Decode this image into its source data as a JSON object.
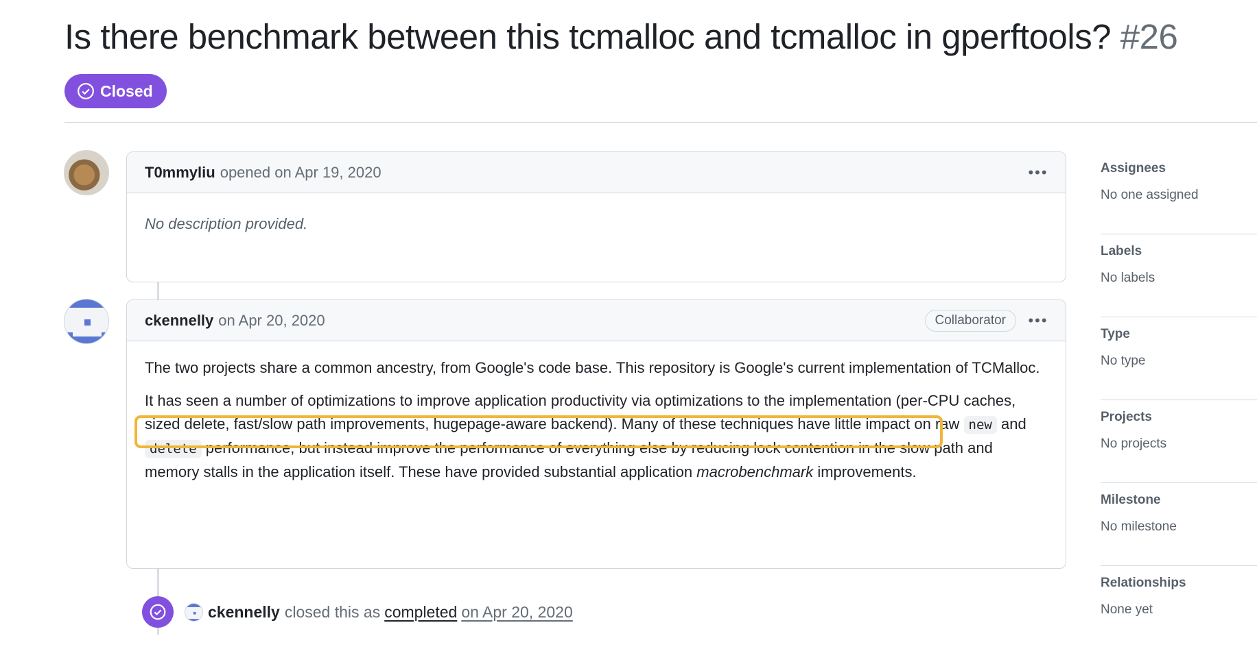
{
  "issue": {
    "title": "Is there benchmark between this tcmalloc and tcmalloc in gperftools?",
    "number": "#26",
    "state": "Closed",
    "state_color": "#8250df"
  },
  "comments": [
    {
      "author": "T0mmyliu",
      "meta": "opened on Apr 19, 2020",
      "body_empty": "No description provided."
    },
    {
      "author": "ckennelly",
      "meta": "on Apr 20, 2020",
      "role_badge": "Collaborator",
      "p1": "The two projects share a common ancestry, from Google's code base. This repository is Google's current implementation of TCMalloc.",
      "p2_a": "It has seen a number of optimizations to improve application productivity via optimizations to the implementation (per-CPU caches, sized delete, fast/slow path improvements, hugepage-aware backend). Many of these techniques have little impact on raw ",
      "code1": "new",
      "p2_b": " and ",
      "code2": "delete",
      "p2_c": " performance, but instead improve the performance of everything else by reducing lock contention in the slow path and memory stalls in the application itself. These have provided substantial application ",
      "p2_em": "macrobenchmark",
      "p2_d": " improvements."
    }
  ],
  "event": {
    "actor": "ckennelly",
    "action": "closed this as",
    "reason": "completed",
    "date": "on Apr 20, 2020"
  },
  "sidebar": [
    {
      "heading": "Assignees",
      "value": "No one assigned"
    },
    {
      "heading": "Labels",
      "value": "No labels"
    },
    {
      "heading": "Type",
      "value": "No type"
    },
    {
      "heading": "Projects",
      "value": "No projects"
    },
    {
      "heading": "Milestone",
      "value": "No milestone"
    },
    {
      "heading": "Relationships",
      "value": "None yet"
    }
  ],
  "icons": {
    "state": "check-circle-icon",
    "more": "kebab-horizontal-icon",
    "event": "check-circle-icon"
  }
}
